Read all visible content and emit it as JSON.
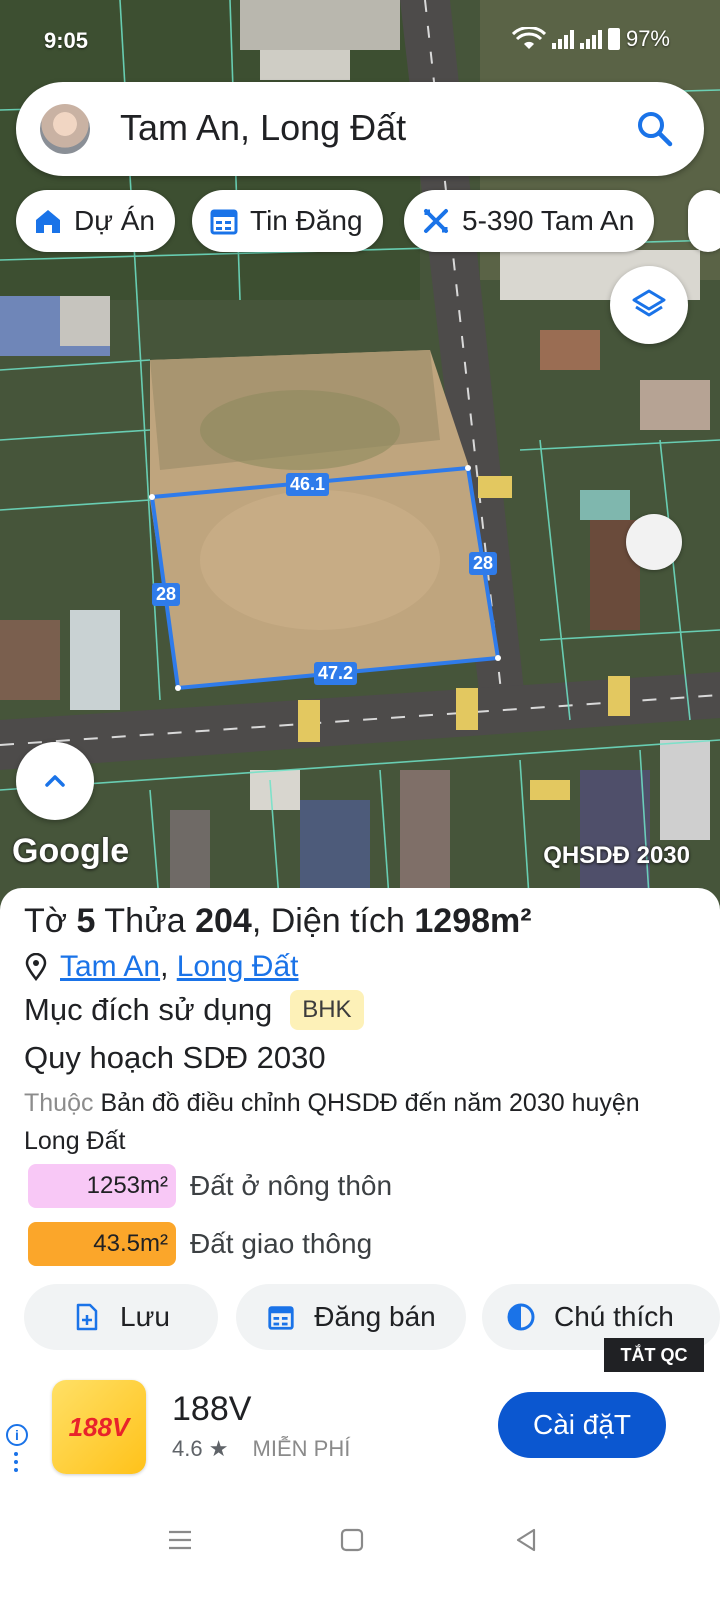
{
  "status_bar": {
    "time": "9:05",
    "battery": "97%"
  },
  "search": {
    "query": "Tam An, Long Đất"
  },
  "chips": [
    {
      "label": "Dự Án",
      "icon": "house-icon"
    },
    {
      "label": "Tin Đăng",
      "icon": "calendar-icon"
    },
    {
      "label": "5-390 Tam An",
      "icon": "ruler-icon"
    }
  ],
  "map": {
    "measurements": {
      "top": "46.1",
      "bottom": "47.2",
      "left": "28",
      "right": "28"
    },
    "watermark": "Google",
    "layer_label": "QHSDĐ 2030"
  },
  "parcel": {
    "sheet_label": "Tờ",
    "sheet_no": "5",
    "parcel_label": "Thửa",
    "parcel_no": "204",
    "area_label": ", Diện tích",
    "area": "1298m²",
    "commune": "Tam An",
    "district": "Long Đất",
    "purpose_label": "Mục đích sử dụng",
    "purpose_code": "BHK",
    "plan_title": "Quy hoạch SDĐ 2030",
    "belongs_label": "Thuộc",
    "belongs_text": "Bản đồ điều chỉnh QHSDĐ đến năm 2030 huyện Long Đất",
    "zones": [
      {
        "area": "1253m²",
        "name": "Đất ở nông thôn",
        "color": "#f8c8f6"
      },
      {
        "area": "43.5m²",
        "name": "Đất giao thông",
        "color": "#fba62a"
      }
    ]
  },
  "actions": [
    {
      "label": "Lưu",
      "icon": "save-icon"
    },
    {
      "label": "Đăng bán",
      "icon": "calendar-icon"
    },
    {
      "label": "Chú thích",
      "icon": "contrast-icon"
    }
  ],
  "ad": {
    "hide_label": "TẮT QC",
    "app_icon_text": "188V",
    "app_name": "188V",
    "rating": "4.6 ★",
    "price": "MIỄN PHÍ",
    "install_label": "Cài đặT"
  },
  "colors": {
    "accent": "#1a73e8",
    "install": "#0b57d0",
    "parcel_line": "#2f7bea"
  }
}
